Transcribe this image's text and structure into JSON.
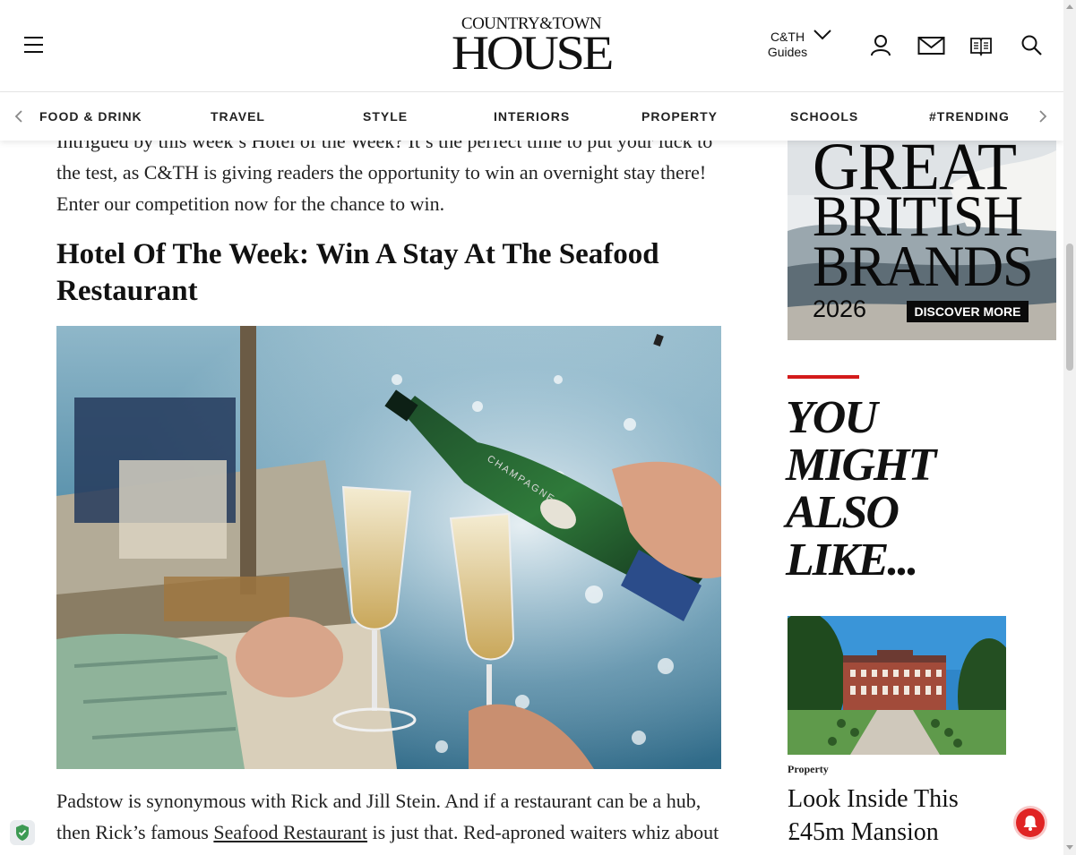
{
  "header": {
    "logo_top": "COUNTRY&TOWN",
    "logo_main": "HOUSE",
    "guides_line1": "C&TH",
    "guides_line2": "Guides"
  },
  "nav": {
    "items": [
      "FOOD & DRINK",
      "TRAVEL",
      "STYLE",
      "INTERIORS",
      "PROPERTY",
      "SCHOOLS",
      "#TRENDING"
    ]
  },
  "article": {
    "intro": "Intrigued by this week’s Hotel of the Week? It’s the perfect time to put your luck to the test, as C&TH is giving readers the opportunity to win an overnight stay there! Enter our competition now for the chance to win.",
    "heading": "Hotel Of The Week: Win A Stay At The Seafood Restaurant",
    "p2_start": "Padstow is synonymous with Rick and Jill Stein. And if a restaurant can be a hub, then Rick’s famous ",
    "p2_link": "Seafood Restaurant",
    "p2_end": " is just that. Red-aproned waiters whiz about in the airy, colourful dining room and a cheerful seafood bar",
    "bottle_label": "CHAMPAGNE"
  },
  "sidebar": {
    "ad_line1": "GREAT",
    "ad_line2": "BRITISH",
    "ad_line3": "BRANDS",
    "ad_year": "2026",
    "ad_button": "DISCOVER MORE",
    "ymal_title": "YOU MIGHT ALSO LIKE...",
    "card_category": "Property",
    "card_title": "Look Inside This £45m Mansion"
  },
  "icons": [
    "menu-icon",
    "chevron-down-icon",
    "user-icon",
    "mail-icon",
    "book-icon",
    "search-icon",
    "chevron-left-icon",
    "chevron-right-icon",
    "shield-icon",
    "bell-icon"
  ],
  "colors": {
    "accent_red": "#d41b1b",
    "text": "#111111",
    "ad_button_bg": "#0a0a0a"
  }
}
